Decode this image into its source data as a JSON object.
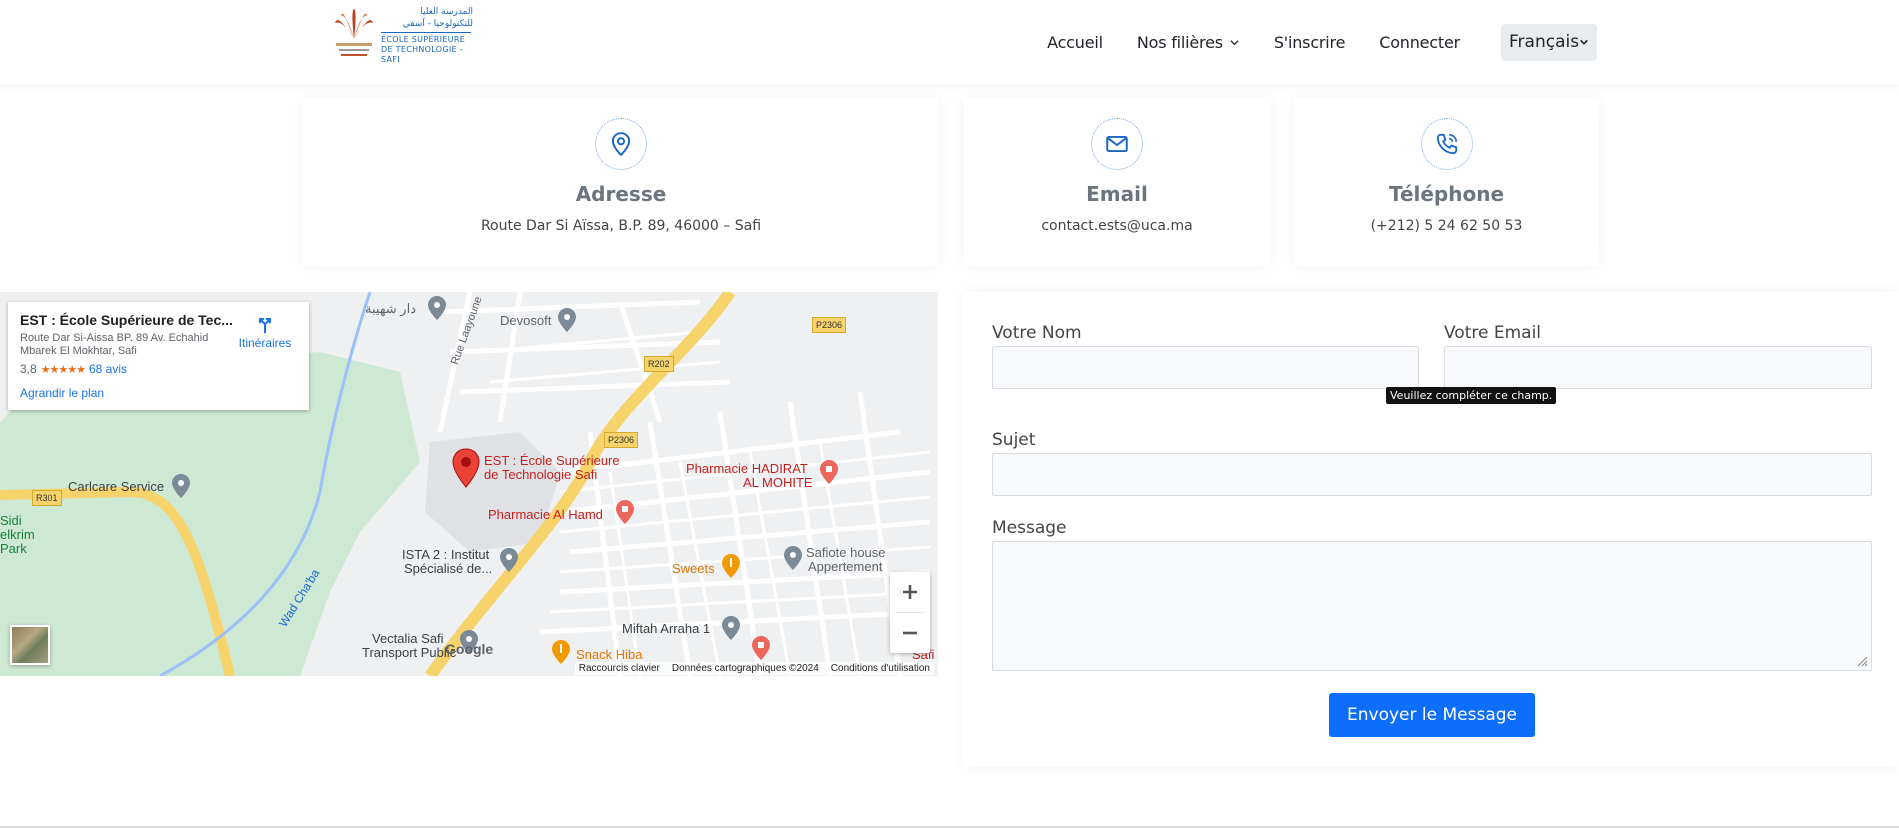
{
  "header": {
    "logo": {
      "ar_line1": "المدرسة العليا",
      "ar_line2": "للتكنولوجيا - آسفي",
      "fr_line1": "ÉCOLE SUPÉRIEURE",
      "fr_line2": "DE TECHNOLOGIE -SAFI"
    },
    "nav": {
      "home": "Accueil",
      "programs": "Nos filières",
      "register": "S'inscrire",
      "login": "Connecter"
    },
    "language": "Français"
  },
  "cards": {
    "address": {
      "icon": "location-pin-icon",
      "title": "Adresse",
      "text": "Route Dar Si Aïssa, B.P. 89, 46000 – Safi"
    },
    "email": {
      "icon": "envelope-icon",
      "title": "Email",
      "text": "contact.ests@uca.ma"
    },
    "phone": {
      "icon": "phone-icon",
      "title": "Téléphone",
      "text": "(+212) 5 24 62 50 53"
    }
  },
  "map": {
    "place_title": "EST : École Supérieure de Tec...",
    "place_address": "Route Dar Si-Aissa BP. 89 Av. Echahid Mbarek El Mokhtar, Safi",
    "rating": "3,8",
    "stars": "★★★★★",
    "reviews": "68 avis",
    "enlarge": "Agrandir le plan",
    "directions": "Itinéraires",
    "labels": {
      "dar": "دار شهيبة",
      "devosoft": "Devosoft",
      "road_p2306_a": "P2306",
      "road_p2306_b": "P2306",
      "road_r202": "R202",
      "road_r301": "R301",
      "rue_laayoune": "Rue Laayoune",
      "est_marker_1": "EST : École Supérieure",
      "est_marker_2": "de Technologie Safi",
      "pharm_hadirat_1": "Pharmacie HADIRAT",
      "pharm_hadirat_2": "AL MOHITE",
      "pharm_alhamd": "Pharmacie Al Hamd",
      "carlcare": "Carlcare Service",
      "sidi_1": "Sidi",
      "sidi_2": "elkrim",
      "sidi_3": "Park",
      "ista_1": "ISTA 2 : Institut",
      "ista_2": "Spécialisé de...",
      "sweets": "Sweets",
      "safiote_1": "Safiote house",
      "safiote_2": "Appertement",
      "wad": "Wad Cha'ba",
      "vectalia_1": "Vectalia Safi",
      "vectalia_2": "Transport Public",
      "miftah": "Miftah Arraha 1",
      "snack": "Snack Hiba",
      "safi_edge": "Safi"
    },
    "footer": {
      "shortcuts": "Raccourcis clavier",
      "mapdata": "Données cartographiques ©2024",
      "terms": "Conditions d'utilisation"
    },
    "google": "Google"
  },
  "form": {
    "name_label": "Votre Nom",
    "email_label": "Votre Email",
    "subject_label": "Sujet",
    "message_label": "Message",
    "tooltip": "Veuillez compléter ce champ.",
    "submit": "Envoyer le Message"
  },
  "colors": {
    "accent": "#0d6efd",
    "map_road": "#f7d36b",
    "map_park": "#cde8d3",
    "map_marker": "#ea4335"
  }
}
